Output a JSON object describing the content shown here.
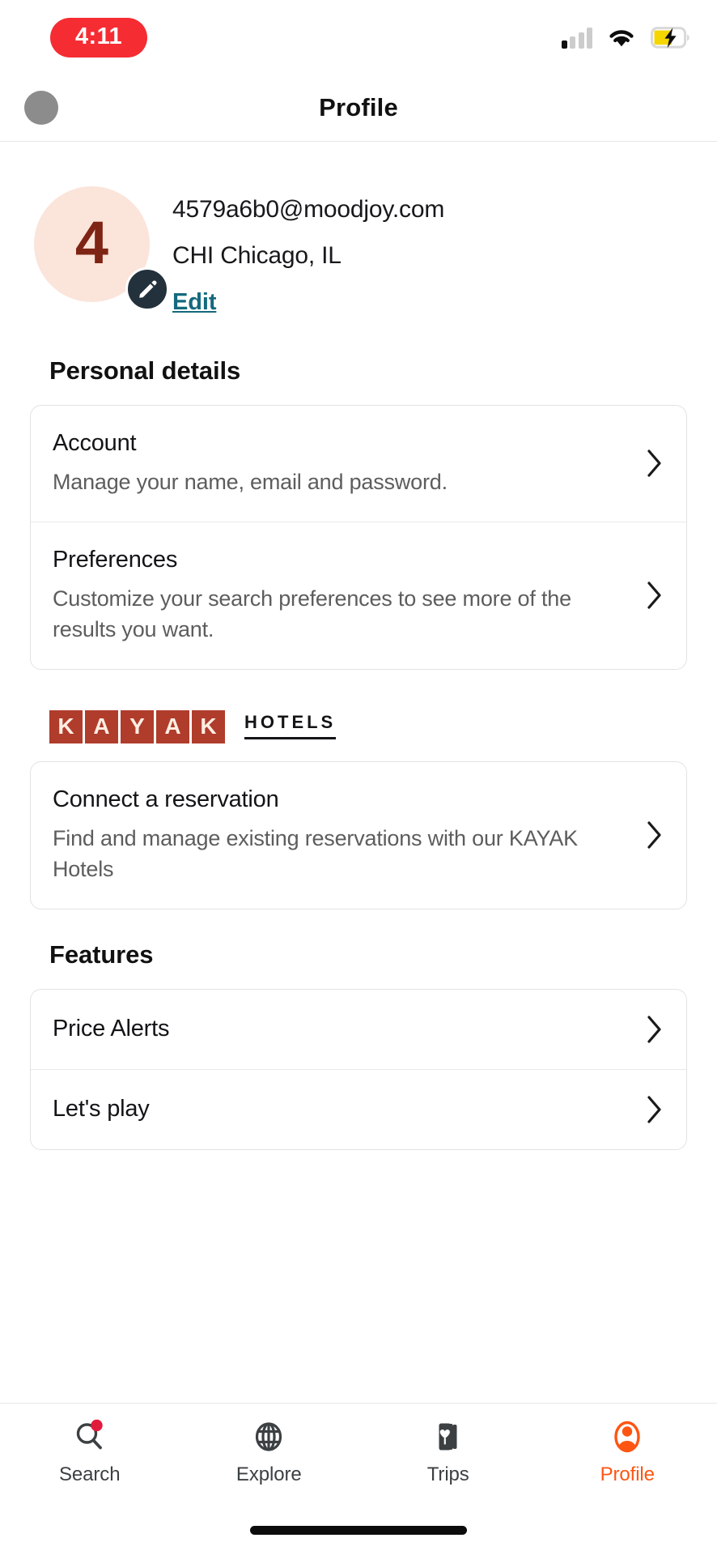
{
  "status_bar": {
    "time": "4:11",
    "time_pill_color": "#f62c33",
    "signal_icon": "cellular-signal-icon",
    "signal_bars_total": 4,
    "signal_bars_active": 1,
    "wifi_icon": "wifi-icon",
    "battery_icon": "battery-charging-icon",
    "battery_color": "#f5d600"
  },
  "header": {
    "title": "Profile",
    "avatar_icon": "avatar-placeholder"
  },
  "profile": {
    "avatar_initial": "4",
    "avatar_bg": "#fbe4da",
    "avatar_text_color": "#7e2414",
    "email": "4579a6b0@moodjoy.com",
    "location": "CHI Chicago, IL",
    "edit_label": "Edit",
    "edit_link_color": "#14697e",
    "edit_badge_icon": "pencil-icon"
  },
  "personal_details": {
    "title": "Personal details",
    "rows": [
      {
        "title": "Account",
        "subtitle": "Manage your name, email and password.",
        "chevron": "chevron-right-icon"
      },
      {
        "title": "Preferences",
        "subtitle": "Customize your search preferences to see more of the results you want.",
        "chevron": "chevron-right-icon"
      }
    ]
  },
  "kayak": {
    "letters": [
      "K",
      "A",
      "Y",
      "A",
      "K"
    ],
    "word": "HOTELS",
    "tile_color": "#b03c2c",
    "rows": [
      {
        "title": "Connect a reservation",
        "subtitle": "Find and manage existing reservations with our KAYAK Hotels",
        "chevron": "chevron-right-icon"
      }
    ]
  },
  "features": {
    "title": "Features",
    "rows": [
      {
        "title": "Price Alerts",
        "chevron": "chevron-right-icon"
      },
      {
        "title": "Let's play",
        "chevron": "chevron-right-icon"
      }
    ]
  },
  "tabbar": {
    "active_color": "#ff5512",
    "items": [
      {
        "label": "Search",
        "icon": "search-icon",
        "active": false,
        "badge": true
      },
      {
        "label": "Explore",
        "icon": "globe-icon",
        "active": false,
        "badge": false
      },
      {
        "label": "Trips",
        "icon": "cards-heart-icon",
        "active": false,
        "badge": false
      },
      {
        "label": "Profile",
        "icon": "person-icon",
        "active": true,
        "badge": false
      }
    ]
  }
}
